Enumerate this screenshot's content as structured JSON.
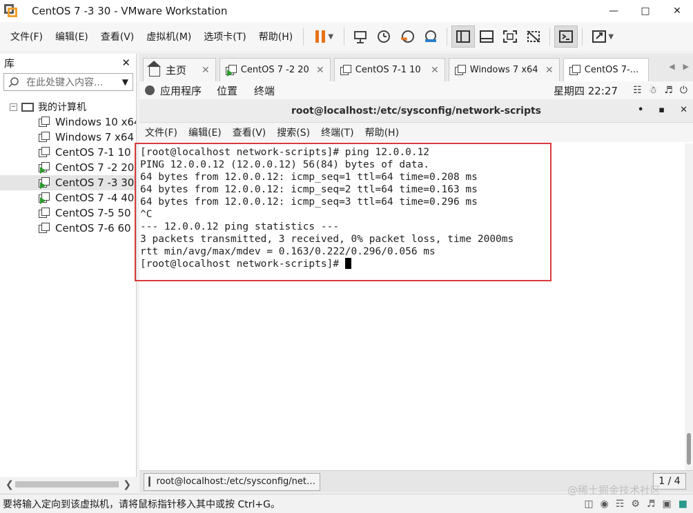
{
  "window": {
    "title": "CentOS 7 -3 30 - VMware Workstation"
  },
  "menubar": {
    "items": [
      "文件(F)",
      "编辑(E)",
      "查看(V)",
      "虚拟机(M)",
      "选项卡(T)",
      "帮助(H)"
    ]
  },
  "toolbar": {
    "icons": [
      "pause-icon",
      "send-keys-icon",
      "snapshot-icon",
      "revert-snapshot-icon",
      "snapshot-manager-icon",
      "library-view-icon",
      "thumbnail-bar-icon",
      "fullscreen-icon",
      "unity-icon",
      "console-icon",
      "stretch-icon"
    ],
    "accent_color": "#e8731a"
  },
  "library": {
    "title": "库",
    "search_placeholder": "在此处键入内容...",
    "root": "我的计算机",
    "items": [
      {
        "label": "Windows 10 x64",
        "running": false,
        "selected": false
      },
      {
        "label": "Windows 7 x64",
        "running": false,
        "selected": false
      },
      {
        "label": "CentOS 7-1  10",
        "running": false,
        "selected": false
      },
      {
        "label": "CentOS 7 -2 20",
        "running": true,
        "selected": false
      },
      {
        "label": "CentOS 7 -3 30",
        "running": true,
        "selected": true
      },
      {
        "label": "CentOS 7 -4 40",
        "running": true,
        "selected": false
      },
      {
        "label": "CentOS 7-5 50",
        "running": false,
        "selected": false
      },
      {
        "label": "CentOS 7-6  60",
        "running": false,
        "selected": false
      }
    ]
  },
  "tabs": [
    {
      "label": "主页",
      "icon": "home-icon",
      "running": false
    },
    {
      "label": "CentOS 7 -2 20",
      "icon": "vm-running-icon",
      "running": true
    },
    {
      "label": "CentOS 7-1  10",
      "icon": "vm-icon",
      "running": false
    },
    {
      "label": "Windows 7 x64",
      "icon": "vm-icon",
      "running": false
    },
    {
      "label": "CentOS 7-...",
      "icon": "vm-icon",
      "running": false
    }
  ],
  "guest": {
    "topbar": {
      "applications": "应用程序",
      "places": "位置",
      "terminal": "终端",
      "clock": "星期四 22:27"
    },
    "terminal": {
      "title": "root@localhost:/etc/sysconfig/network-scripts",
      "menu": [
        "文件(F)",
        "编辑(E)",
        "查看(V)",
        "搜索(S)",
        "终端(T)",
        "帮助(H)"
      ],
      "lines": [
        "[root@localhost network-scripts]# ping 12.0.0.12",
        "PING 12.0.0.12 (12.0.0.12) 56(84) bytes of data.",
        "64 bytes from 12.0.0.12: icmp_seq=1 ttl=64 time=0.208 ms",
        "64 bytes from 12.0.0.12: icmp_seq=2 ttl=64 time=0.163 ms",
        "64 bytes from 12.0.0.12: icmp_seq=3 ttl=64 time=0.296 ms",
        "^C",
        "--- 12.0.0.12 ping statistics ---",
        "3 packets transmitted, 3 received, 0% packet loss, time 2000ms",
        "rtt min/avg/max/mdev = 0.163/0.222/0.296/0.056 ms"
      ],
      "prompt": "[root@localhost network-scripts]# ",
      "highlight_color": "#d93a3a"
    },
    "taskbar": {
      "task_label": "root@localhost:/etc/sysconfig/net…",
      "workspace": "1 / 4"
    }
  },
  "statusbar": {
    "text": "要将输入定向到该虚拟机，请将鼠标指针移入其中或按 Ctrl+G。"
  },
  "watermark": "@稀土掘金技术社区"
}
